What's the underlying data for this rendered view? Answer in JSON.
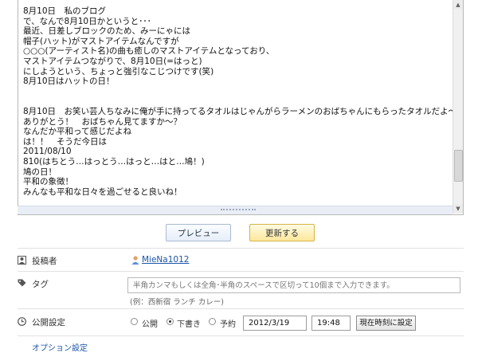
{
  "editor": {
    "lines": [
      "8月10日　私のブログ",
      "で、なんで8月10日かというと･･･",
      "最近、日差しブロックのため、みーにゃには",
      "帽子(ハット)がマストアイテムなんですが",
      "○○○(アーティスト名)の曲も癒しのマストアイテムとなっており、",
      "マストアイテムつながりで、8月10日(=はっと)",
      "にしようという、ちょっと強引なこじつけです(笑)",
      "8月10日はハットの日！",
      "",
      "",
      "8月10日　お笑い芸人ちなみに俺が手に持ってるタオルはじゃんがらラーメンのおばちゃんにもらったタオルだよ～",
      "ありがとう！　おばちゃん見てますか～？",
      "なんだか平和って感じだよね",
      "は！！　そうだ今日は",
      "2011/08/10",
      "810(はちとう…はっとう…はっと…はと…鳩！)",
      "鳩の日！",
      "平和の象徴！",
      "みんなも平和な日々を過ごせると良いね！"
    ]
  },
  "buttons": {
    "preview": "プレビュー",
    "update": "更新する"
  },
  "author": {
    "label": "投稿者",
    "name": "MieNa1012"
  },
  "tag": {
    "label": "タグ",
    "placeholder": "半角カンマもしくは全角･半角のスペースで区切って10個まで入力できます。",
    "example": "(例：西新宿 ランチ カレー)"
  },
  "publish": {
    "label": "公開設定",
    "options": [
      "公開",
      "下書き",
      "予約"
    ],
    "selected": "下書き",
    "date": "2012/3/19",
    "time": "19:48",
    "now_button": "現在時刻に設定"
  },
  "options_label": "オプション設定"
}
